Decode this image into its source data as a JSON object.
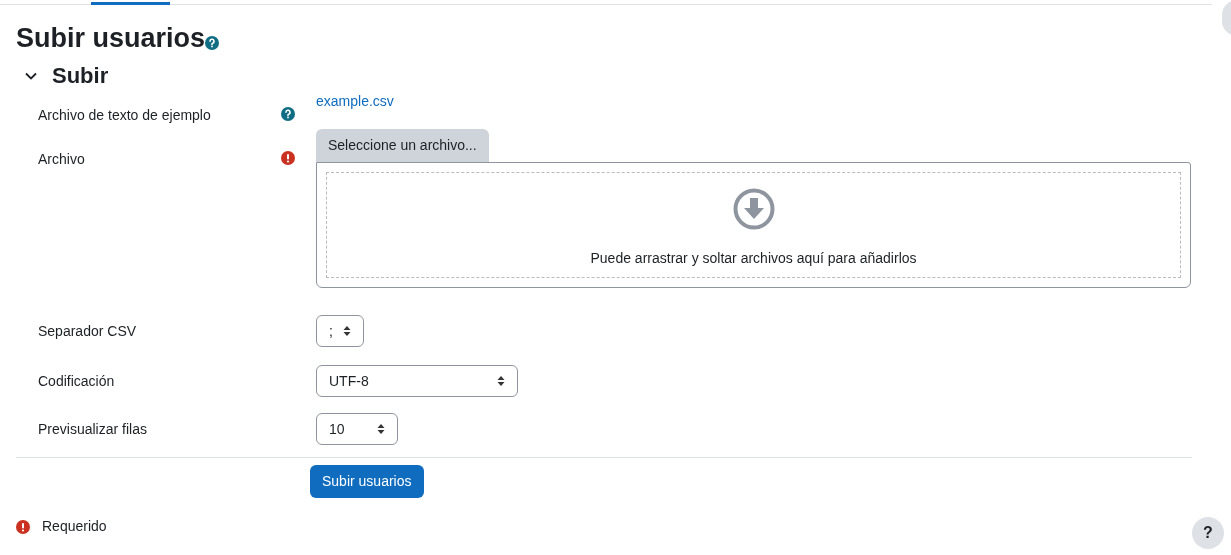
{
  "page_title": "Subir usuarios",
  "section": {
    "title": "Subir",
    "expanded": true
  },
  "fields": [
    {
      "kind": "link",
      "label": "Archivo de texto de ejemplo",
      "help": true,
      "required": false,
      "value": "example.csv"
    },
    {
      "kind": "filepicker",
      "label": "Archivo",
      "help": false,
      "required": true,
      "button": "Seleccione un archivo...",
      "drop_hint": "Puede arrastrar y soltar archivos aquí para añadirlos"
    },
    {
      "kind": "select",
      "label": "Separador CSV",
      "help": false,
      "required": false,
      "value": ";"
    },
    {
      "kind": "select",
      "label": "Codificación",
      "help": false,
      "required": false,
      "value": "UTF-8"
    },
    {
      "kind": "select",
      "label": "Previsualizar filas",
      "help": false,
      "required": false,
      "value": "10"
    }
  ],
  "submit": "Subir usuarios",
  "required_note": "Requerido",
  "help_button": "?"
}
